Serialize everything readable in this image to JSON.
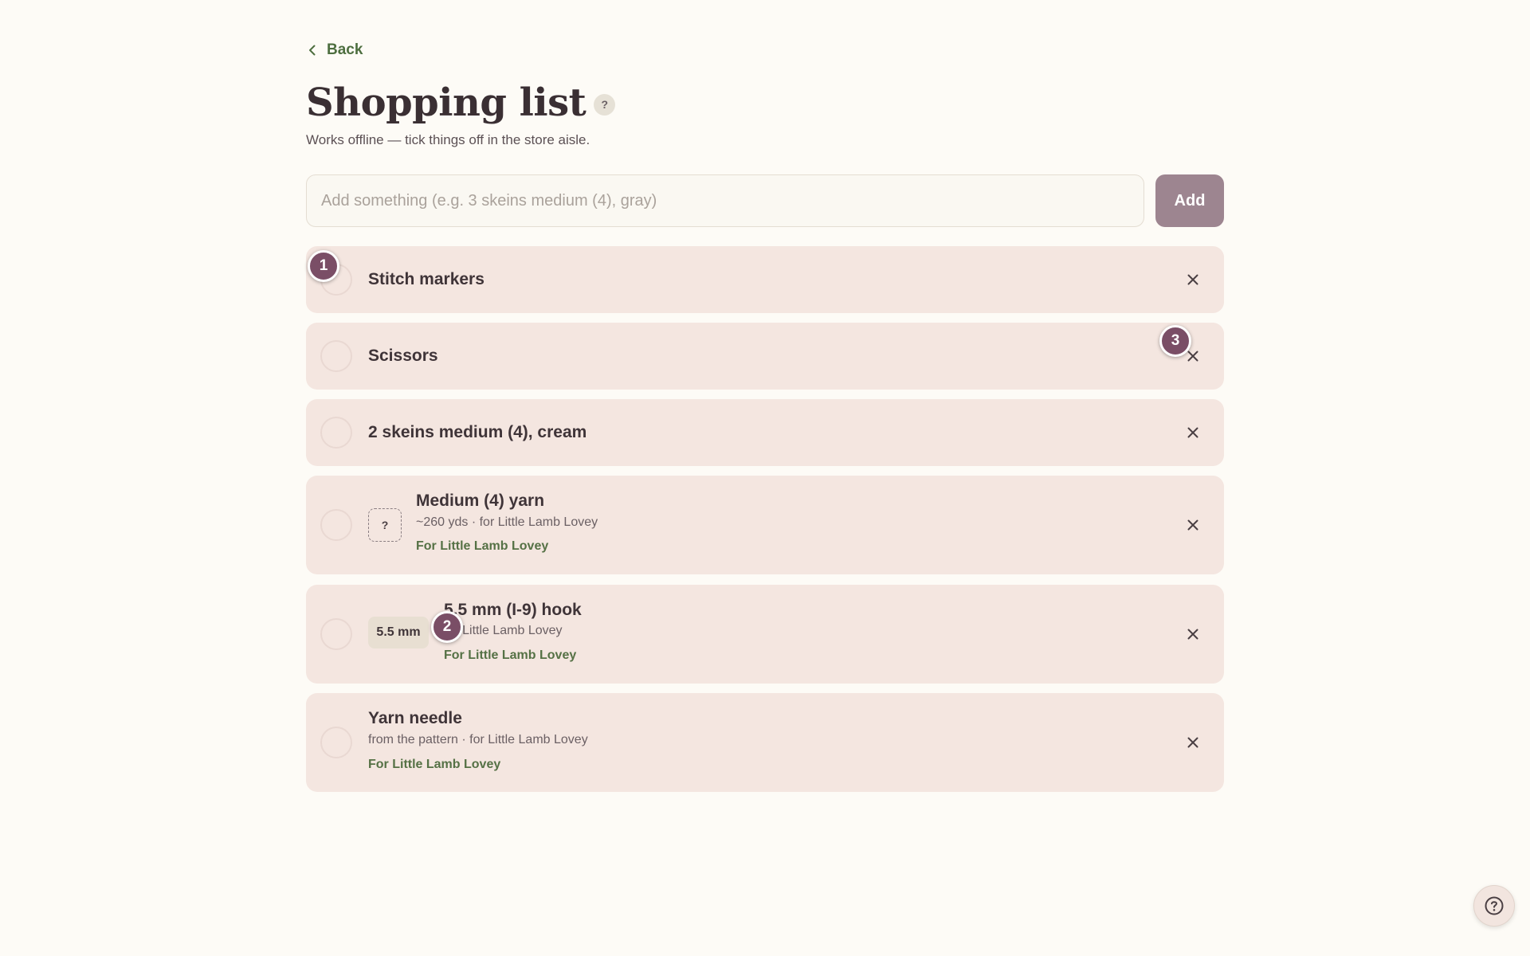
{
  "nav": {
    "back_label": "Back"
  },
  "header": {
    "title": "Shopping list",
    "help_glyph": "?",
    "subtitle": "Works offline — tick things off in the store aisle."
  },
  "add_form": {
    "placeholder": "Add something (e.g. 3 skeins medium (4), gray)",
    "value": "",
    "button_label": "Add"
  },
  "items": [
    {
      "label": "Stitch markers",
      "checked": false
    },
    {
      "label": "Scissors",
      "checked": false
    },
    {
      "label": "2 skeins medium (4), cream",
      "checked": false
    },
    {
      "label": "Medium (4) yarn",
      "icon_glyph": "?",
      "meta": "~260 yds · for Little Lamb Lovey",
      "tag": "For Little Lamb Lovey",
      "checked": false
    },
    {
      "label": "5.5 mm (I-9) hook",
      "chip": "5.5 mm",
      "meta": "for Little Lamb Lovey",
      "tag": "For Little Lamb Lovey",
      "checked": false
    },
    {
      "label": "Yarn needle",
      "meta": "from the pattern · for Little Lamb Lovey",
      "tag": "For Little Lamb Lovey",
      "checked": false
    }
  ],
  "markers": [
    "1",
    "2",
    "3"
  ],
  "colors": {
    "background": "#fdfbf6",
    "card": "#f4e6e0",
    "accent_green": "#557145",
    "add_button": "#9d8590",
    "marker": "#7a4e66"
  },
  "icons": {
    "back": "chevron-left-icon",
    "remove": "close-icon",
    "help": "question-circle-icon"
  }
}
